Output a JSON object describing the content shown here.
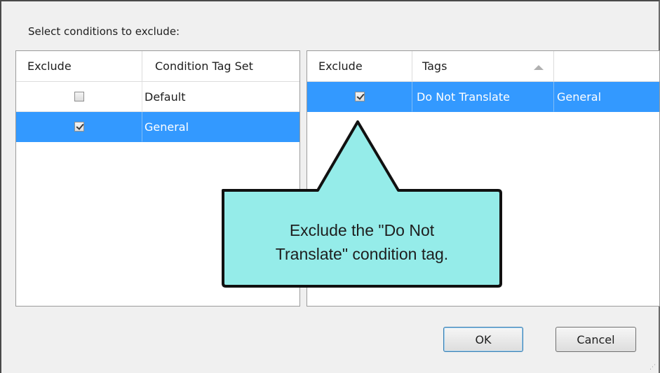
{
  "dialog": {
    "prompt": "Select conditions to exclude:"
  },
  "left_table": {
    "headers": [
      "Exclude",
      "Condition Tag Set"
    ],
    "rows": [
      {
        "checked": false,
        "label": "Default",
        "selected": false
      },
      {
        "checked": true,
        "label": "General",
        "selected": true
      }
    ]
  },
  "right_table": {
    "headers": [
      "Exclude",
      "Tags",
      ""
    ],
    "sort_column": "Tags",
    "rows": [
      {
        "checked": true,
        "tag": "Do Not Translate",
        "set": "General",
        "selected": true
      }
    ]
  },
  "buttons": {
    "ok": "OK",
    "cancel": "Cancel"
  },
  "callout": {
    "line1": "Exclude the \"Do Not",
    "line2": "Translate\" condition tag.",
    "fill_color": "#95ece9"
  },
  "colors": {
    "selection": "#3399ff"
  }
}
